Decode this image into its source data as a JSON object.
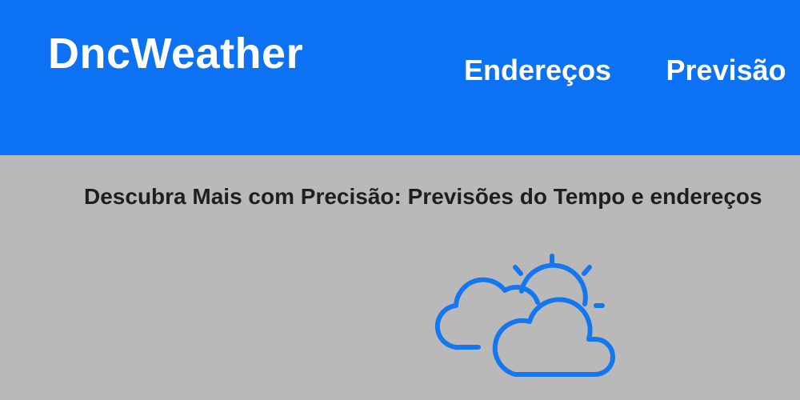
{
  "header": {
    "brand": "DncWeather",
    "nav": [
      {
        "label": "Endereços"
      },
      {
        "label": "Previsão"
      }
    ]
  },
  "main": {
    "headline": "Descubra Mais com Precisão: Previsões do Tempo e endereços",
    "icon": "partly-cloudy-icon"
  },
  "colors": {
    "header_bg": "#0c71f2",
    "page_bg": "#b9b9b9",
    "accent": "#1577ef",
    "text_dark": "#1f1f1f"
  }
}
